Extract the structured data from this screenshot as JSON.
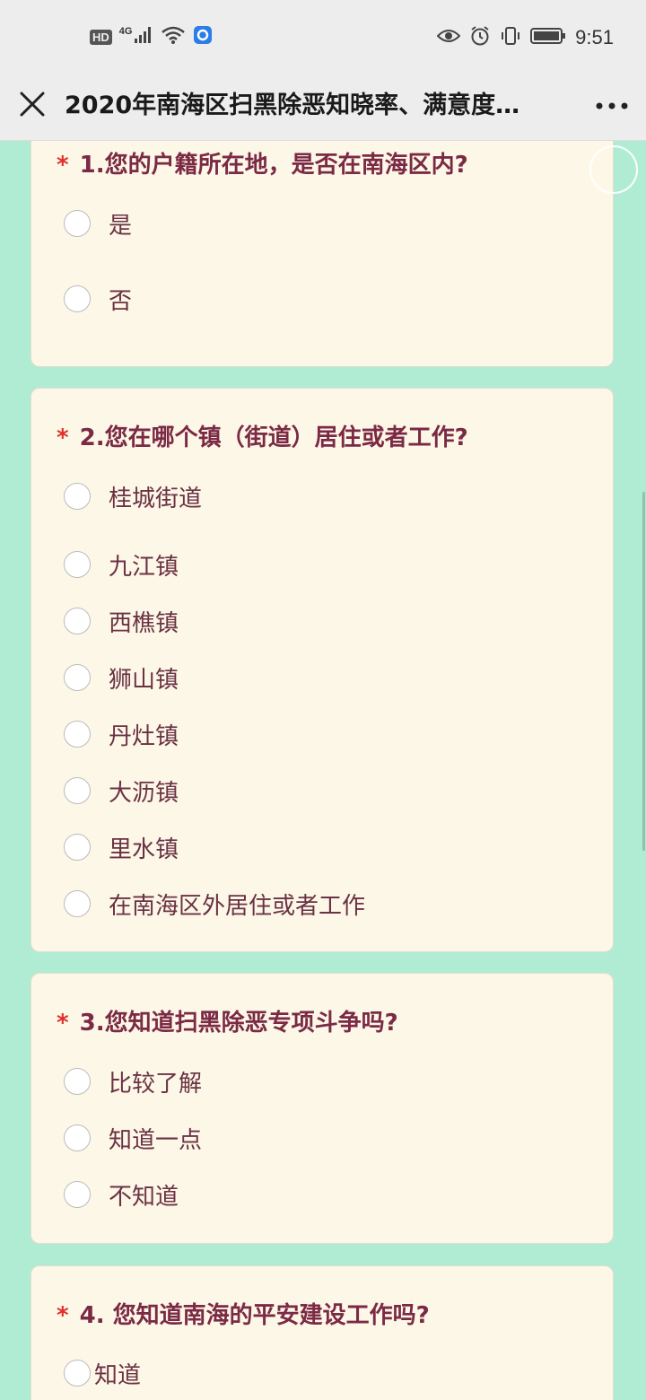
{
  "status_bar": {
    "hd": "HD",
    "network": "4G",
    "time": "9:51",
    "icons": [
      "hd-badge",
      "signal-icon",
      "wifi-icon",
      "app-notification-icon",
      "eye-icon",
      "alarm-icon",
      "vibrate-icon",
      "battery-icon"
    ]
  },
  "nav": {
    "title": "2020年南海区扫黑除恶知晓率、满意度…",
    "close_icon": "close-icon",
    "more_icon": "more-icon"
  },
  "questions": [
    {
      "required_mark": "*",
      "title": "1.您的户籍所在地，是否在南海区内?",
      "options": [
        "是",
        "否"
      ]
    },
    {
      "required_mark": "*",
      "title": "2.您在哪个镇（街道）居住或者工作?",
      "options": [
        "桂城街道",
        "九江镇",
        "西樵镇",
        "狮山镇",
        "丹灶镇",
        "大沥镇",
        "里水镇",
        "在南海区外居住或者工作"
      ]
    },
    {
      "required_mark": "*",
      "title": "3.您知道扫黑除恶专项斗争吗?",
      "options": [
        "比较了解",
        "知道一点",
        "不知道"
      ]
    },
    {
      "required_mark": "*",
      "title": "4. 您知道南海的平安建设工作吗?",
      "options": [
        "知道"
      ]
    }
  ],
  "colors": {
    "page_bg": "#b0ecd4",
    "card_bg": "#fdf7e7",
    "question_text": "#7b2a45",
    "required": "#e0312c"
  }
}
